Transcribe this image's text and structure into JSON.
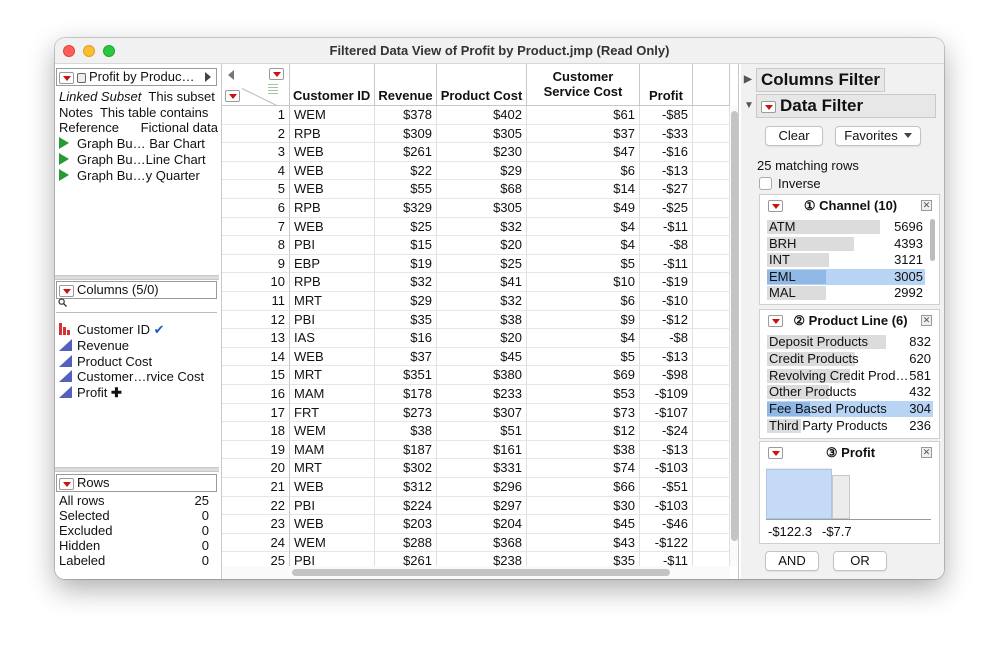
{
  "window": {
    "title": "Filtered Data View of Profit by Product.jmp (Read Only)"
  },
  "table_panel": {
    "name": "Profit by Produc…",
    "props": [
      {
        "key": "Linked Subset",
        "value": "This subset"
      },
      {
        "key": "Notes",
        "value": "This table contains"
      },
      {
        "key": "Reference",
        "value": "Fictional data"
      }
    ],
    "scripts": [
      "Graph Bu… Bar Chart",
      "Graph Bu…Line Chart",
      "Graph Bu…y Quarter"
    ]
  },
  "columns_panel": {
    "header": "Columns (5/0)",
    "search_icon": "magnifier-icon",
    "items": [
      {
        "name": "Customer ID",
        "type": "nominal",
        "badge": "✔"
      },
      {
        "name": "Revenue",
        "type": "continuous",
        "badge": ""
      },
      {
        "name": "Product Cost",
        "type": "continuous",
        "badge": ""
      },
      {
        "name": "Customer…rvice Cost",
        "type": "continuous",
        "badge": ""
      },
      {
        "name": "Profit",
        "type": "continuous",
        "badge": "✚"
      }
    ]
  },
  "rows_panel": {
    "header": "Rows",
    "items": [
      {
        "label": "All rows",
        "count": "25"
      },
      {
        "label": "Selected",
        "count": "0"
      },
      {
        "label": "Excluded",
        "count": "0"
      },
      {
        "label": "Hidden",
        "count": "0"
      },
      {
        "label": "Labeled",
        "count": "0"
      }
    ]
  },
  "grid": {
    "headers": [
      {
        "line1": "",
        "line2": "Customer ID"
      },
      {
        "line1": "",
        "line2": "Revenue"
      },
      {
        "line1": "",
        "line2": "Product Cost"
      },
      {
        "line1": "Customer",
        "line2": "Service Cost"
      },
      {
        "line1": "",
        "line2": "Profit"
      }
    ],
    "rows": [
      [
        "1",
        "WEM",
        "$378",
        "$402",
        "$61",
        "-$85"
      ],
      [
        "2",
        "RPB",
        "$309",
        "$305",
        "$37",
        "-$33"
      ],
      [
        "3",
        "WEB",
        "$261",
        "$230",
        "$47",
        "-$16"
      ],
      [
        "4",
        "WEB",
        "$22",
        "$29",
        "$6",
        "-$13"
      ],
      [
        "5",
        "WEB",
        "$55",
        "$68",
        "$14",
        "-$27"
      ],
      [
        "6",
        "RPB",
        "$329",
        "$305",
        "$49",
        "-$25"
      ],
      [
        "7",
        "WEB",
        "$25",
        "$32",
        "$4",
        "-$11"
      ],
      [
        "8",
        "PBI",
        "$15",
        "$20",
        "$4",
        "-$8"
      ],
      [
        "9",
        "EBP",
        "$19",
        "$25",
        "$5",
        "-$11"
      ],
      [
        "10",
        "RPB",
        "$32",
        "$41",
        "$10",
        "-$19"
      ],
      [
        "11",
        "MRT",
        "$29",
        "$32",
        "$6",
        "-$10"
      ],
      [
        "12",
        "PBI",
        "$35",
        "$38",
        "$9",
        "-$12"
      ],
      [
        "13",
        "IAS",
        "$16",
        "$20",
        "$4",
        "-$8"
      ],
      [
        "14",
        "WEB",
        "$37",
        "$45",
        "$5",
        "-$13"
      ],
      [
        "15",
        "MRT",
        "$351",
        "$380",
        "$69",
        "-$98"
      ],
      [
        "16",
        "MAM",
        "$178",
        "$233",
        "$53",
        "-$109"
      ],
      [
        "17",
        "FRT",
        "$273",
        "$307",
        "$73",
        "-$107"
      ],
      [
        "18",
        "WEM",
        "$38",
        "$51",
        "$12",
        "-$24"
      ],
      [
        "19",
        "MAM",
        "$187",
        "$161",
        "$38",
        "-$13"
      ],
      [
        "20",
        "MRT",
        "$302",
        "$331",
        "$74",
        "-$103"
      ],
      [
        "21",
        "WEB",
        "$312",
        "$296",
        "$66",
        "-$51"
      ],
      [
        "22",
        "PBI",
        "$224",
        "$297",
        "$30",
        "-$103"
      ],
      [
        "23",
        "WEB",
        "$203",
        "$204",
        "$45",
        "-$46"
      ],
      [
        "24",
        "WEM",
        "$288",
        "$368",
        "$43",
        "-$122"
      ],
      [
        "25",
        "PBI",
        "$261",
        "$238",
        "$35",
        "-$11"
      ]
    ]
  },
  "filter": {
    "columns_filter_title": "Columns Filter",
    "data_filter_title": "Data Filter",
    "clear_label": "Clear",
    "favorites_label": "Favorites",
    "matching_rows": "25 matching rows",
    "inverse_label": "Inverse",
    "and_label": "AND",
    "or_label": "OR",
    "channel": {
      "title": "① Channel (10)",
      "levels": [
        {
          "name": "ATM",
          "count": "5696",
          "value": 5696,
          "selected": false
        },
        {
          "name": "BRH",
          "count": "4393",
          "value": 4393,
          "selected": false
        },
        {
          "name": "INT",
          "count": "3121",
          "value": 3121,
          "selected": false
        },
        {
          "name": "EML",
          "count": "3005",
          "value": 3005,
          "selected": true
        },
        {
          "name": "MAL",
          "count": "2992",
          "value": 2992,
          "selected": false
        }
      ]
    },
    "product_line": {
      "title": "② Product Line (6)",
      "levels": [
        {
          "name": "Deposit Products",
          "count": "832",
          "value": 832,
          "selected": false
        },
        {
          "name": "Credit Products",
          "count": "620",
          "value": 620,
          "selected": false
        },
        {
          "name": "Revolving Credit Prod…",
          "count": "581",
          "value": 581,
          "selected": false
        },
        {
          "name": "Other Products",
          "count": "432",
          "value": 432,
          "selected": false
        },
        {
          "name": "Fee Based Products",
          "count": "304",
          "value": 304,
          "selected": true
        },
        {
          "name": "Third Party Products",
          "count": "236",
          "value": 236,
          "selected": false
        }
      ]
    },
    "profit": {
      "title": "③ Profit",
      "min_label": "-$122.3",
      "max_label": "-$7.7"
    }
  }
}
